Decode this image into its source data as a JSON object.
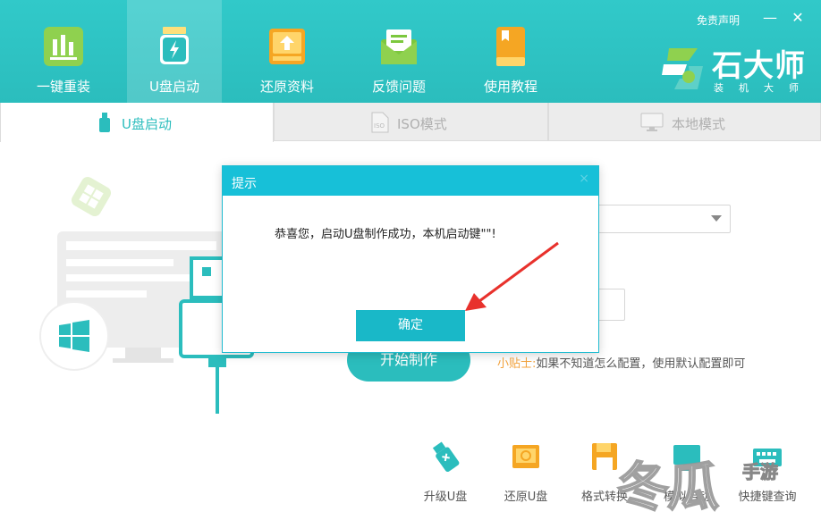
{
  "header": {
    "nav_items": [
      {
        "label": "一键重装",
        "icon": "chart-bars-icon"
      },
      {
        "label": "U盘启动",
        "icon": "usb-drive-icon"
      },
      {
        "label": "还原资料",
        "icon": "restore-upload-icon"
      },
      {
        "label": "反馈问题",
        "icon": "envelope-icon"
      },
      {
        "label": "使用教程",
        "icon": "book-icon"
      }
    ],
    "disclaimer": "免责声明",
    "minimize_glyph": "—",
    "close_glyph": "✕",
    "logo_text": "石大师",
    "logo_sub": "装机大师"
  },
  "tabs": [
    {
      "label": "U盘启动",
      "icon": "usb-icon"
    },
    {
      "label": "ISO模式",
      "icon": "iso-file-icon"
    },
    {
      "label": "本地模式",
      "icon": "monitor-icon"
    }
  ],
  "main": {
    "start_button": "开始制作",
    "tip_label": "小贴士:",
    "tip_text": "如果不知道怎么配置，使用默认配置即可"
  },
  "tools": [
    {
      "label": "升级U盘",
      "icon": "usb-upgrade-icon"
    },
    {
      "label": "还原U盘",
      "icon": "usb-restore-icon"
    },
    {
      "label": "格式转换",
      "icon": "floppy-disk-icon"
    },
    {
      "label": "模拟启动",
      "icon": "simulate-boot-icon"
    },
    {
      "label": "快捷键查询",
      "icon": "keyboard-icon"
    }
  ],
  "dialog": {
    "title": "提示",
    "message": "恭喜您，启动U盘制作成功，本机启动键\"\"!",
    "ok_button": "确定",
    "close_glyph": "×"
  },
  "watermark": {
    "text": "冬瓜",
    "sub": "手游"
  },
  "colors": {
    "accent": "#2bbdbd",
    "dialog_header": "#17c0d8",
    "ok_button": "#19b8c8",
    "tip_label": "#f3a23b",
    "arrow": "#e8312c"
  }
}
